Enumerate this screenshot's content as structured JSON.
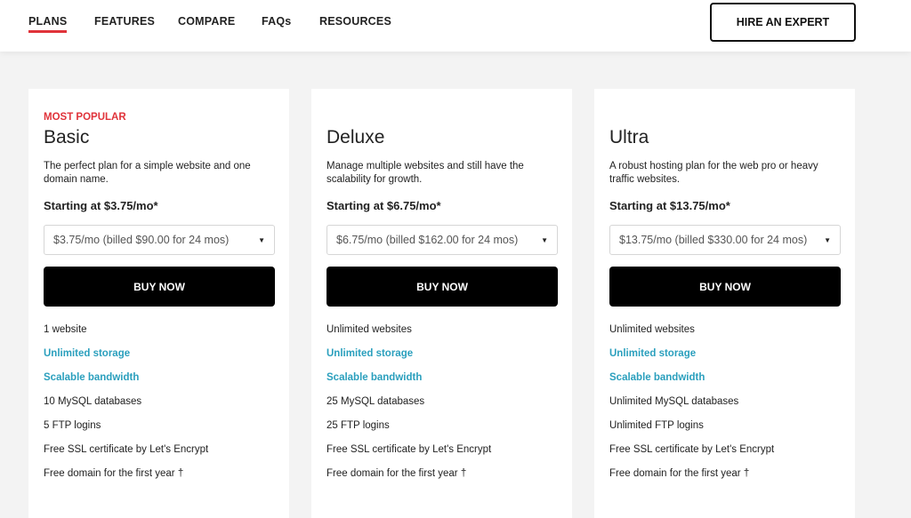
{
  "nav": {
    "items": [
      {
        "label": "PLANS",
        "active": true
      },
      {
        "label": "FEATURES",
        "active": false
      },
      {
        "label": "COMPARE",
        "active": false
      },
      {
        "label": "FAQs",
        "active": false
      },
      {
        "label": "RESOURCES",
        "active": false
      }
    ],
    "hire_label": "HIRE AN EXPERT"
  },
  "colors": {
    "accent_red": "#e0333a",
    "link_blue": "#2a9fbd",
    "button_black": "#000000"
  },
  "plans": [
    {
      "badge": "MOST POPULAR",
      "name": "Basic",
      "description": "The perfect plan for a simple website and one domain name.",
      "price": "Starting at $3.75/mo*",
      "billing_selected": "$3.75/mo (billed $90.00 for 24 mos)",
      "buy_label": "BUY NOW",
      "features": [
        {
          "text": "1 website",
          "link": false
        },
        {
          "text": "Unlimited storage",
          "link": true
        },
        {
          "text": "Scalable bandwidth",
          "link": true
        },
        {
          "text": "10 MySQL databases",
          "link": false
        },
        {
          "text": "5 FTP logins",
          "link": false
        },
        {
          "text": "Free SSL certificate by Let's Encrypt",
          "link": false
        },
        {
          "text": "Free domain for the first year †",
          "link": false
        }
      ]
    },
    {
      "badge": "",
      "name": "Deluxe",
      "description": "Manage multiple websites and still have the scalability for growth.",
      "price": "Starting at $6.75/mo*",
      "billing_selected": "$6.75/mo (billed $162.00 for 24 mos)",
      "buy_label": "BUY NOW",
      "features": [
        {
          "text": "Unlimited websites",
          "link": false
        },
        {
          "text": "Unlimited storage",
          "link": true
        },
        {
          "text": "Scalable bandwidth",
          "link": true
        },
        {
          "text": "25 MySQL databases",
          "link": false
        },
        {
          "text": "25 FTP logins",
          "link": false
        },
        {
          "text": "Free SSL certificate by Let's Encrypt",
          "link": false
        },
        {
          "text": "Free domain for the first year †",
          "link": false
        }
      ]
    },
    {
      "badge": "",
      "name": "Ultra",
      "description": "A robust hosting plan for the web pro or heavy traffic websites.",
      "price": "Starting at $13.75/mo*",
      "billing_selected": "$13.75/mo (billed $330.00 for 24 mos)",
      "buy_label": "BUY NOW",
      "features": [
        {
          "text": "Unlimited websites",
          "link": false
        },
        {
          "text": "Unlimited storage",
          "link": true
        },
        {
          "text": "Scalable bandwidth",
          "link": true
        },
        {
          "text": "Unlimited MySQL databases",
          "link": false
        },
        {
          "text": "Unlimited FTP logins",
          "link": false
        },
        {
          "text": "Free SSL certificate by Let's Encrypt",
          "link": false
        },
        {
          "text": "Free domain for the first year †",
          "link": false
        }
      ]
    }
  ]
}
